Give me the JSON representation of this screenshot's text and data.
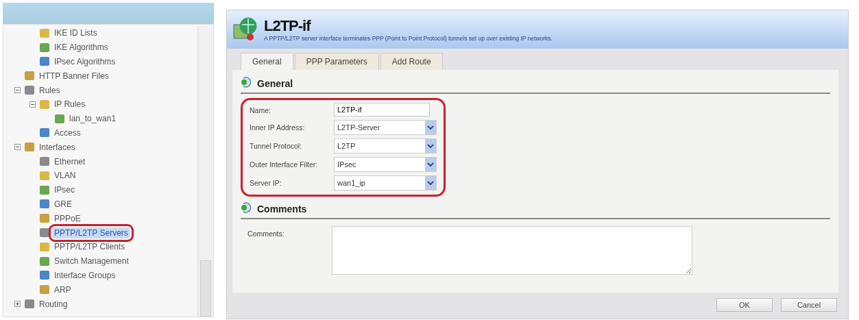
{
  "tree": {
    "items": [
      {
        "children": [
          {
            "children": [
              {
                "label": "IKE ID Lists",
                "selected": false,
                "highlighted": false
              },
              {
                "label": "IKE Algorithms",
                "selected": false,
                "highlighted": false
              },
              {
                "label": "IPsec Algorithms",
                "selected": false,
                "highlighted": false
              }
            ]
          },
          {
            "label": "HTTP Banner Files",
            "selected": false,
            "highlighted": false
          }
        ]
      },
      {
        "label": "Rules",
        "expanded": true,
        "selected": false,
        "highlighted": false,
        "children": [
          {
            "label": "IP Rules",
            "expanded": true,
            "selected": false,
            "highlighted": false,
            "children": [
              {
                "label": "lan_to_wan1",
                "selected": false,
                "highlighted": false
              }
            ]
          },
          {
            "label": "Access",
            "selected": false,
            "highlighted": false
          }
        ]
      },
      {
        "label": "Interfaces",
        "expanded": true,
        "selected": false,
        "highlighted": false,
        "children": [
          {
            "label": "Ethernet",
            "selected": false,
            "highlighted": false
          },
          {
            "label": "VLAN",
            "selected": false,
            "highlighted": false
          },
          {
            "label": "IPsec",
            "selected": false,
            "highlighted": false
          },
          {
            "label": "GRE",
            "selected": false,
            "highlighted": false
          },
          {
            "label": "PPPoE",
            "selected": false,
            "highlighted": false
          },
          {
            "label": "PPTP/L2TP Servers",
            "selected": true,
            "highlighted": true
          },
          {
            "label": "PPTP/L2TP Clients",
            "selected": false,
            "highlighted": false
          },
          {
            "label": "Switch Management",
            "selected": false,
            "highlighted": false
          },
          {
            "label": "Interface Groups",
            "selected": false,
            "highlighted": false
          },
          {
            "label": "ARP",
            "selected": false,
            "highlighted": false
          }
        ]
      },
      {
        "label": "Routing",
        "expanded": false,
        "selected": false,
        "highlighted": false
      }
    ]
  },
  "header": {
    "title": "L2TP-if",
    "description": "A PPTP/L2TP server interface terminates PPP (Point to Point Protocol) tunnels set up over existing IP networks."
  },
  "tabs": [
    {
      "label": "General",
      "selected": true
    },
    {
      "label": "PPP Parameters",
      "selected": false
    },
    {
      "label": "Add Route",
      "selected": false
    }
  ],
  "sections": [
    {
      "title": "General",
      "highlighted": true,
      "fields": [
        {
          "kind": "text",
          "label": "Name:",
          "value": "L2TP-if"
        },
        {
          "kind": "select",
          "label": "Inner IP Address:",
          "value": "L2TP-Server"
        },
        {
          "kind": "select",
          "label": "Tunnel Protocol:",
          "value": "L2TP"
        },
        {
          "kind": "select",
          "label": "Outer Interface Filter:",
          "value": "IPsec"
        },
        {
          "kind": "select",
          "label": "Server IP:",
          "value": "wan1_ip"
        }
      ]
    },
    {
      "title": "Comments",
      "highlighted": false,
      "fields": [
        {
          "kind": "textarea",
          "label": "Comments:"
        }
      ]
    }
  ],
  "buttons": [
    "OK",
    "Cancel"
  ]
}
